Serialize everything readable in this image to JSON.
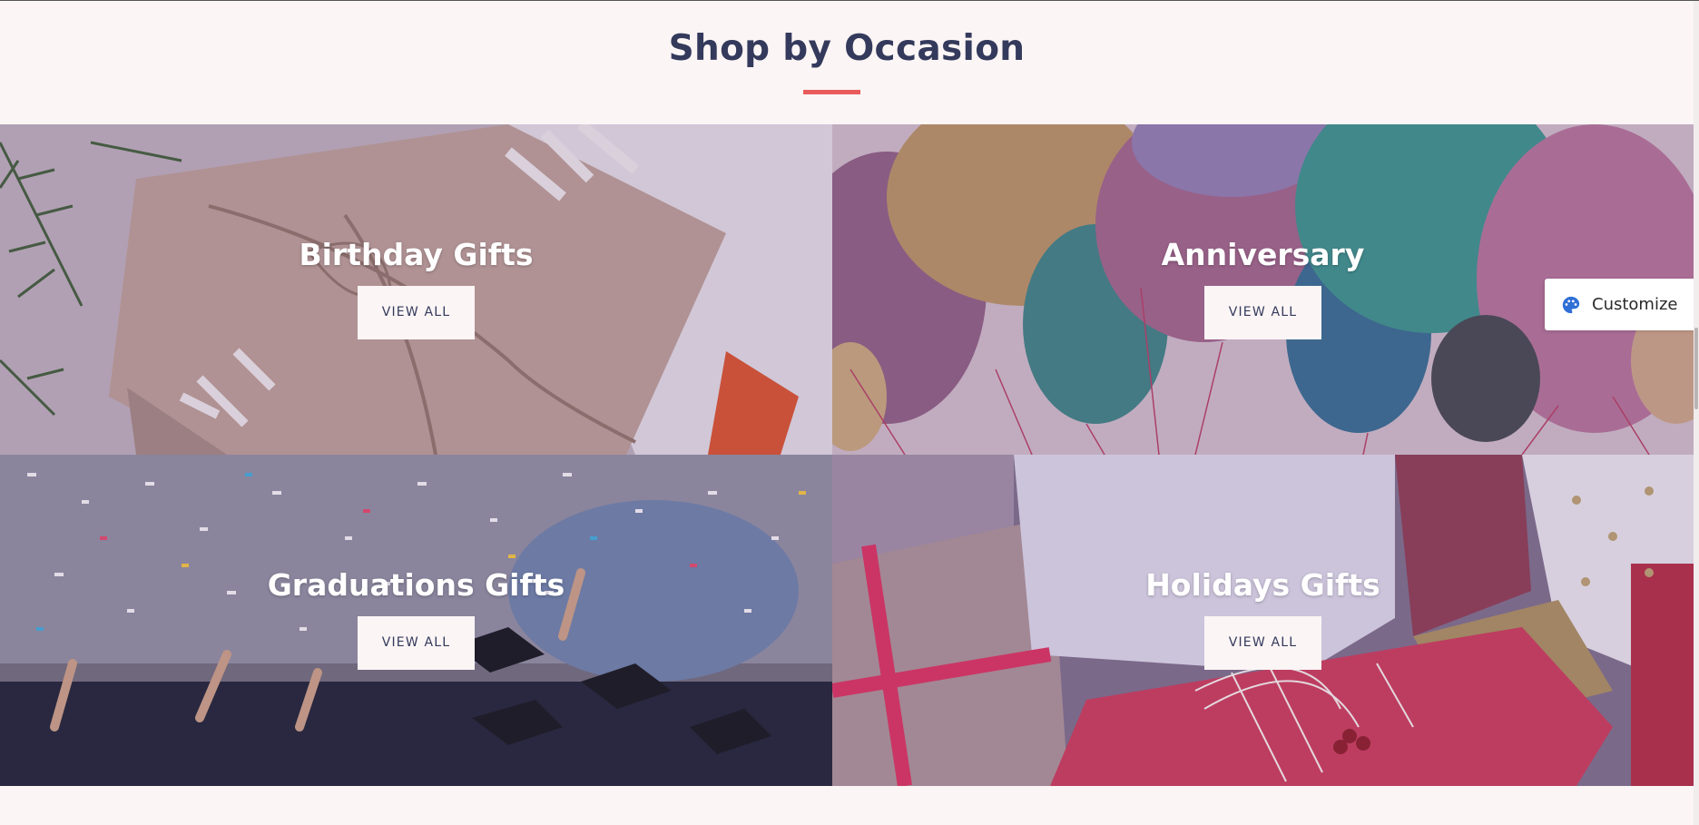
{
  "section": {
    "title": "Shop by Occasion"
  },
  "tiles": [
    {
      "title": "Birthday Gifts",
      "button": "VIEW ALL",
      "image": "kraft-gift-box-photo"
    },
    {
      "title": "Anniversary",
      "button": "VIEW ALL",
      "image": "metallic-balloons-photo"
    },
    {
      "title": "Graduations Gifts",
      "button": "VIEW ALL",
      "image": "graduation-confetti-photo"
    },
    {
      "title": "Holidays Gifts",
      "button": "VIEW ALL",
      "image": "wrapped-presents-photo"
    }
  ],
  "customize": {
    "label": "Customize",
    "icon": "palette-icon"
  },
  "colors": {
    "background": "#fbf5f5",
    "heading": "#343a5c",
    "accent": "#e85b5b",
    "customize_icon": "#2f6fd6"
  }
}
